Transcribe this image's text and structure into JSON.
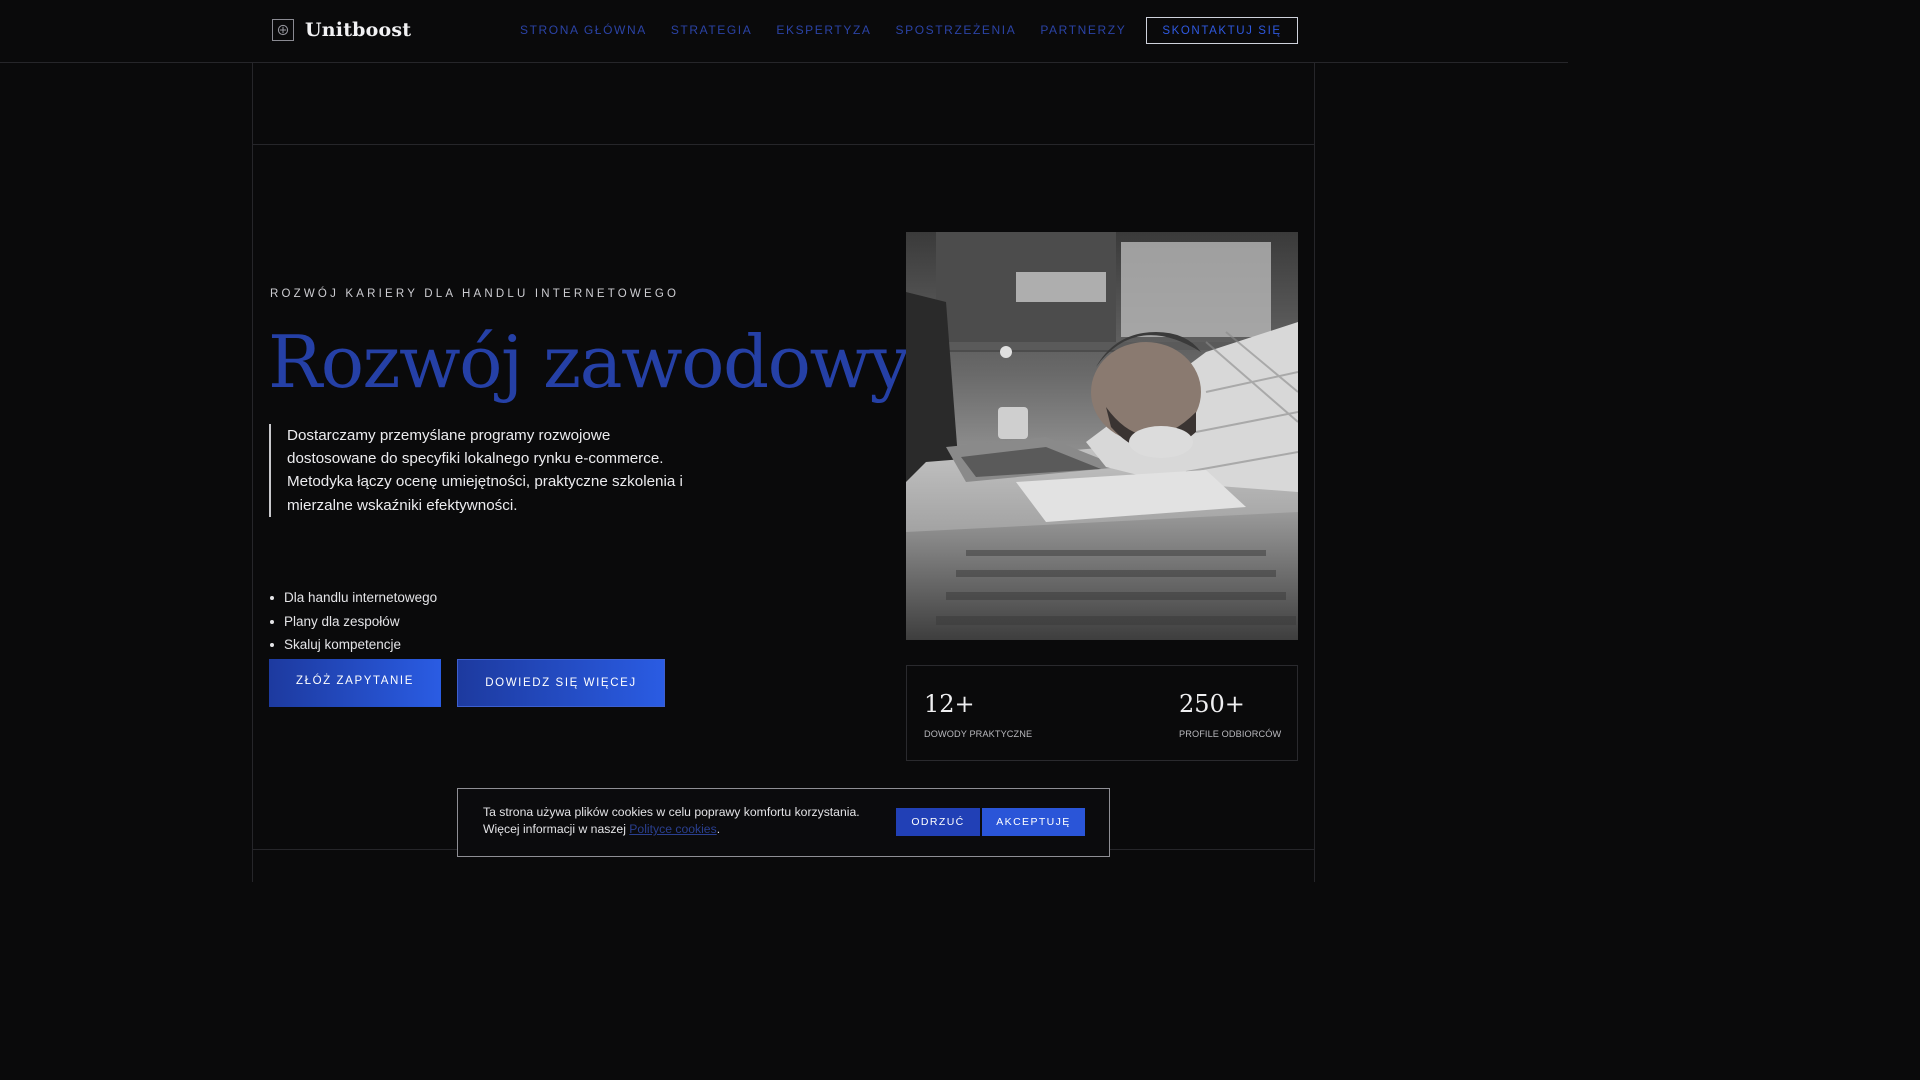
{
  "brand": {
    "name": "Unitboost",
    "icon": "plus-circle-icon"
  },
  "nav": {
    "items": [
      "STRONA GŁÓWNA",
      "STRATEGIA",
      "EKSPERTYZA",
      "SPOSTRZEŻENIA",
      "PARTNERZY"
    ],
    "cta": "SKONTAKTUJ SIĘ"
  },
  "hero": {
    "eyebrow": "ROZWÓJ KARIERY DLA HANDLU INTERNETOWEGO",
    "title": "Rozwój zawodowy",
    "lead": "Dostarczamy przemyślane programy rozwojowe dostosowane do specyfiki lokalnego rynku e-commerce. Metodyka łączy ocenę umiejętności, praktyczne szkolenia i mierzalne wskaźniki efektywności.",
    "features": [
      "Dla handlu internetowego",
      "Plany dla zespołów",
      "Skaluj kompetencje"
    ],
    "primary_button": "ZŁÓŻ ZAPYTANIE",
    "secondary_button": "DOWIEDZ SIĘ WIĘCEJ"
  },
  "stats": [
    {
      "value": "12+",
      "label": "DOWODY PRAKTYCZNE"
    },
    {
      "value": "250+",
      "label": "PROFILE ODBIORCÓW"
    }
  ],
  "cookie": {
    "text_before": "Ta strona używa plików cookies w celu poprawy komfortu korzystania. Więcej informacji w naszej ",
    "link": "Polityce cookies",
    "text_after": ".",
    "reject": "ODRZUĆ",
    "accept": "AKCEPTUJĘ"
  },
  "colors": {
    "background": "#0a0a0b",
    "accent": "#2540a6",
    "button_gradient_start": "#1d3a9f",
    "button_gradient_end": "#2a5ce3"
  }
}
